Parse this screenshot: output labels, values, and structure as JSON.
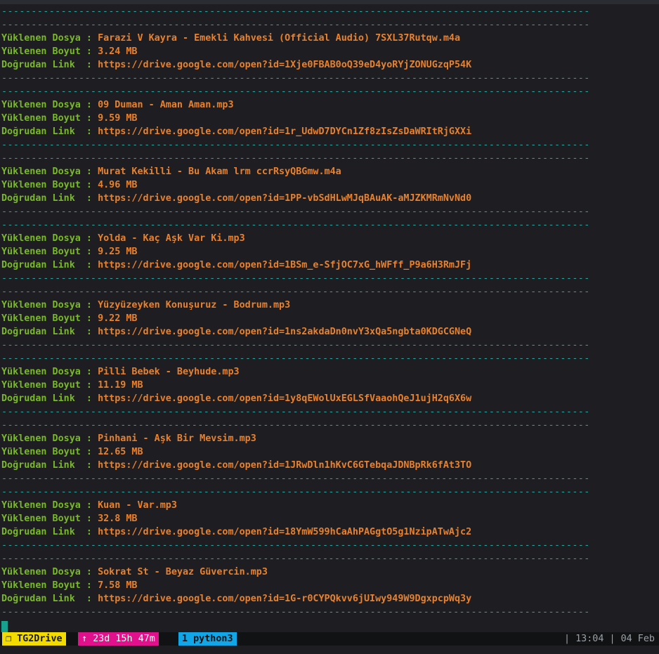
{
  "colors": {
    "background": "#1e1e22",
    "separator": "#2aa198",
    "label": "#79b829",
    "value": "#e7812e",
    "cursor": "#18a08e",
    "status_session": "#f2dc00",
    "status_uptime": "#e0118a",
    "status_window": "#11a6e8"
  },
  "separator": "---------------------------------------------------------------------------------------------------",
  "labels": {
    "file": "Yüklenen Dosya : ",
    "size": "Yüklenen Boyut : ",
    "link": "Doğrudan Link  : "
  },
  "uploads": [
    {
      "file": "Farazi V Kayra - Emekli Kahvesi (Official Audio) 7SXL37Rutqw.m4a",
      "size": "3.24 MB",
      "link": "https://drive.google.com/open?id=1Xje0FBAB0oQ39eD4yoRYjZONUGzqP54K"
    },
    {
      "file": "09 Duman - Aman Aman.mp3",
      "size": "9.59 MB",
      "link": "https://drive.google.com/open?id=1r_UdwD7DYCn1Zf8zIsZsDaWRItRjGXXi"
    },
    {
      "file": "Murat Kekilli - Bu Akam lrm ccrRsyQBGmw.m4a",
      "size": "4.96 MB",
      "link": "https://drive.google.com/open?id=1PP-vbSdHLwMJqBAuAK-aMJZKMRmNvNd0"
    },
    {
      "file": "Yolda - Kaç Aşk Var Ki.mp3",
      "size": "9.25 MB",
      "link": "https://drive.google.com/open?id=1BSm_e-SfjOC7xG_hWFff_P9a6H3RmJFj"
    },
    {
      "file": "Yüzyüzeyken Konuşuruz - Bodrum.mp3",
      "size": "9.22 MB",
      "link": "https://drive.google.com/open?id=1ns2akdaDn0nvY3xQa5ngbta0KDGCGNeQ"
    },
    {
      "file": "Pilli Bebek - Beyhude.mp3",
      "size": "11.19 MB",
      "link": "https://drive.google.com/open?id=1y8qEWolUxEGLSfVaaohQeJ1ujH2q6X6w"
    },
    {
      "file": "Pinhani - Aşk Bir Mevsim.mp3",
      "size": "12.65 MB",
      "link": "https://drive.google.com/open?id=1JRwDln1hKvC6GTebqaJDNBpRk6fAt3TO"
    },
    {
      "file": "Kuan - Var.mp3",
      "size": "32.8 MB",
      "link": "https://drive.google.com/open?id=18YmW599hCaAhPAGgtO5g1NzipATwAjc2"
    },
    {
      "file": "Sokrat St - Beyaz Güvercin.mp3",
      "size": "7.58 MB",
      "link": "https://drive.google.com/open?id=1G-r0CYPQkvv6jUIwy949W9DgxpcpWq3y"
    }
  ],
  "statusbar": {
    "session": "❐ TG2Drive",
    "uptime": "↑ 23d 15h 47m",
    "window": "1 python3",
    "clock": "| 13:04 | 04 Feb"
  }
}
